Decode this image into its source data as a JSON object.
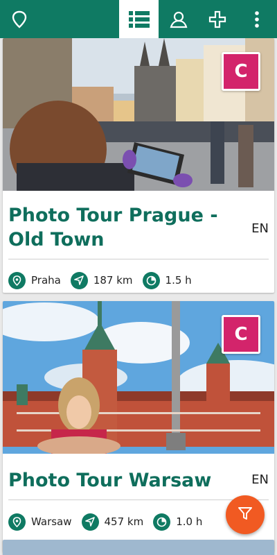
{
  "app_bar": {
    "icons": [
      "map-pin-icon",
      "list-icon",
      "person-icon",
      "plus-icon",
      "more-vertical-icon"
    ],
    "active_tab": "list",
    "color": "#0f7a63"
  },
  "tours": [
    {
      "title": "Photo Tour Prague - Old Town",
      "language": "EN",
      "badge": "C",
      "location": "Praha",
      "distance": "187 km",
      "duration": "1.5 h"
    },
    {
      "title": "Photo Tour Warsaw",
      "language": "EN",
      "badge": "C",
      "location": "Warsaw",
      "distance": "457 km",
      "duration": "1.0 h"
    }
  ],
  "filter_button": {
    "icon": "filter-icon",
    "color": "#f15a22"
  },
  "colors": {
    "primary": "#0f7a63",
    "title": "#0f6e5c",
    "badge": "#d3246b"
  }
}
